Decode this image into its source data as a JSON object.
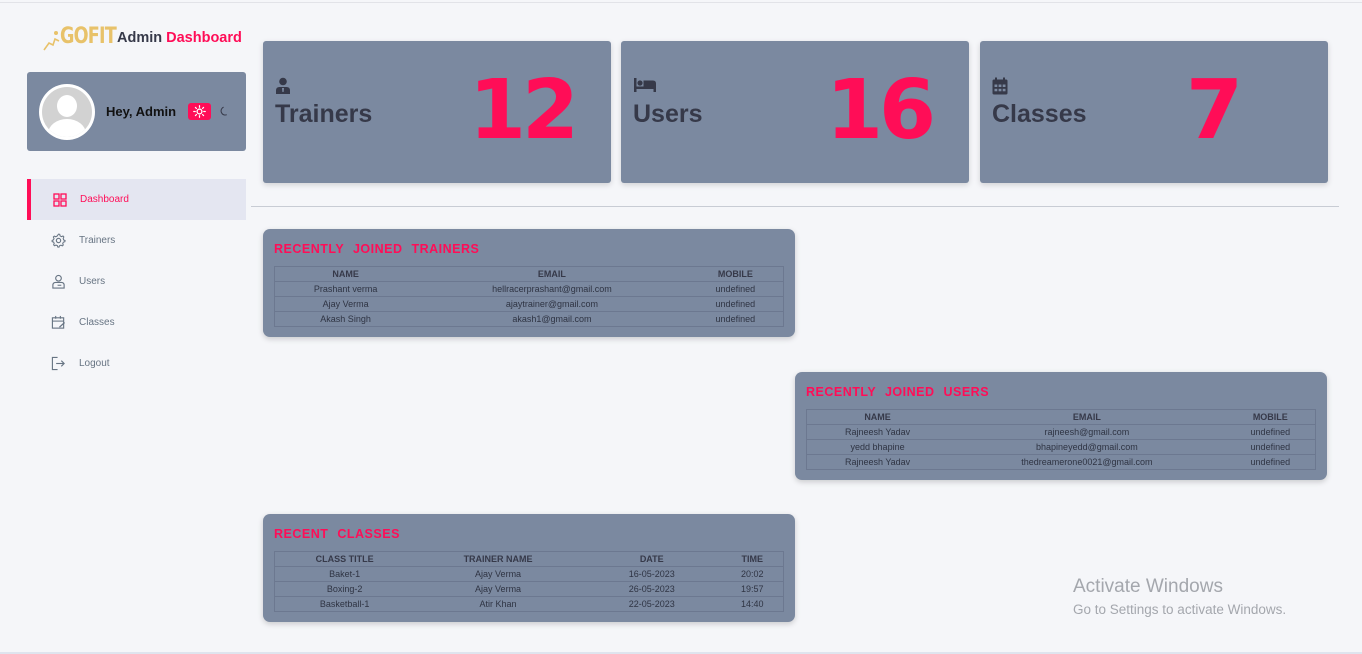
{
  "brand": {
    "logo_text": "GOFIT",
    "title_part1": "Admin",
    "title_part2": "Dashboard",
    "accent_color": "#ff0d57"
  },
  "profile": {
    "greeting": "Hey, Admin",
    "theme_icons": [
      "sun-icon",
      "moon-icon"
    ]
  },
  "nav": {
    "items": [
      {
        "label": "Dashboard",
        "icon": "grid-icon",
        "active": true
      },
      {
        "label": "Trainers",
        "icon": "gear-icon",
        "active": false
      },
      {
        "label": "Users",
        "icon": "user-icon",
        "active": false
      },
      {
        "label": "Classes",
        "icon": "calendar-icon",
        "active": false
      },
      {
        "label": "Logout",
        "icon": "logout-icon",
        "active": false
      }
    ]
  },
  "stats": [
    {
      "label": "Trainers",
      "value": "12",
      "icon": "user-tie-icon"
    },
    {
      "label": "Users",
      "value": "16",
      "icon": "bed-icon"
    },
    {
      "label": "Classes",
      "value": "7",
      "icon": "calendar-icon"
    }
  ],
  "trainers_table": {
    "title": "RECENTLY JOINED TRAINERS",
    "headers": [
      "NAME",
      "EMAIL",
      "MOBILE"
    ],
    "rows": [
      [
        "Prashant verma",
        "hellracerprashant@gmail.com",
        "undefined"
      ],
      [
        "Ajay Verma",
        "ajaytrainer@gmail.com",
        "undefined"
      ],
      [
        "Akash Singh",
        "akash1@gmail.com",
        "undefined"
      ]
    ]
  },
  "users_table": {
    "title": "RECENTLY JOINED USERS",
    "headers": [
      "NAME",
      "EMAIL",
      "MOBILE"
    ],
    "rows": [
      [
        "Rajneesh Yadav",
        "rajneesh@gmail.com",
        "undefined"
      ],
      [
        "yedd bhapine",
        "bhapineyedd@gmail.com",
        "undefined"
      ],
      [
        "Rajneesh Yadav",
        "thedreamerone0021@gmail.com",
        "undefined"
      ]
    ]
  },
  "classes_table": {
    "title": "RECENT CLASSES",
    "headers": [
      "CLASS TITLE",
      "TRAINER NAME",
      "DATE",
      "TIME"
    ],
    "rows": [
      [
        "Baket-1",
        "Ajay Verma",
        "16-05-2023",
        "20:02"
      ],
      [
        "Boxing-2",
        "Ajay Verma",
        "26-05-2023",
        "19:57"
      ],
      [
        "Basketball-1",
        "Atir Khan",
        "22-05-2023",
        "14:40"
      ]
    ]
  },
  "watermark": {
    "line1": "Activate Windows",
    "line2": "Go to Settings to activate Windows."
  }
}
